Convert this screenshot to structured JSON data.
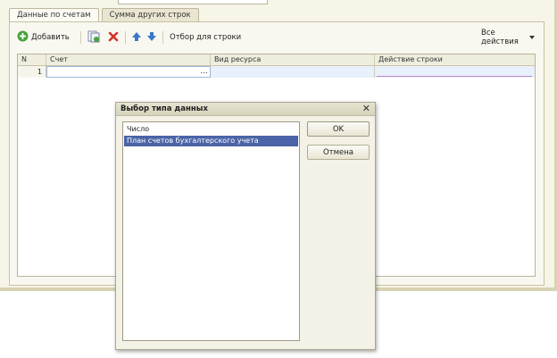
{
  "tabs": [
    {
      "label": "Данные по счетам",
      "active": true
    },
    {
      "label": "Сумма других строк",
      "active": false
    }
  ],
  "toolbar": {
    "add_label": "Добавить",
    "filter_label": "Отбор для строки",
    "all_actions_label": "Все действия",
    "icons": [
      "add-icon",
      "copy-icon",
      "delete-icon",
      "move-up-icon",
      "move-down-icon",
      "dropdown-arrow-icon"
    ]
  },
  "grid": {
    "columns": [
      "N",
      "Счет",
      "Вид ресурса",
      "Действие строки"
    ],
    "rows": [
      {
        "n": "1",
        "account": "",
        "resource": "",
        "action": ""
      }
    ],
    "ellipsis": "..."
  },
  "dialog": {
    "title": "Выбор типа данных",
    "items": [
      {
        "label": "Число",
        "selected": false
      },
      {
        "label": "План счетов бухгалтерского учета",
        "selected": true
      }
    ],
    "ok_label": "OK",
    "cancel_label": "Отмена"
  },
  "colors": {
    "background": "#f7f5e8",
    "selection": "#4b64a7",
    "row_highlight": "#e8f0fb",
    "delete_red": "#d2362c",
    "arrow_blue": "#3a78c9"
  }
}
